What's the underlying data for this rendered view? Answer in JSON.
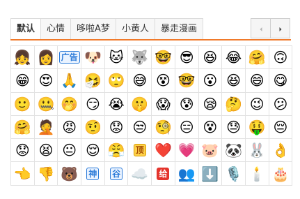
{
  "tabs": [
    {
      "label": "默认",
      "active": true
    },
    {
      "label": "心情",
      "active": false
    },
    {
      "label": "哆啦A梦",
      "active": false
    },
    {
      "label": "小黄人",
      "active": false
    },
    {
      "label": "暴走漫画",
      "active": false
    }
  ],
  "pager": {
    "prev_icon": "chevron-left-icon",
    "next_icon": "chevron-right-icon"
  },
  "colors": {
    "accent": "#f07a2b",
    "border": "#e2e2e2"
  },
  "emoticons": [
    [
      {
        "name": "girl-face-icon",
        "glyph": "👧"
      },
      {
        "name": "shy-girl-face-icon",
        "glyph": "👩"
      },
      {
        "name": "text-bubble-icon",
        "glyph": "广告",
        "style": "text"
      },
      {
        "name": "doge-icon",
        "glyph": "🐶"
      },
      {
        "name": "cat-face-icon",
        "glyph": "🐱"
      },
      {
        "name": "husky-icon",
        "glyph": "🐺"
      },
      {
        "name": "minion-icon",
        "glyph": "🤓"
      },
      {
        "name": "minion-goggles-icon",
        "glyph": "😎"
      },
      {
        "name": "minion-laugh-icon",
        "glyph": "😆"
      },
      {
        "name": "tears-of-joy-icon",
        "glyph": "😂"
      },
      {
        "name": "smile-hands-icon",
        "glyph": "🤗"
      },
      {
        "name": "shrug-icon",
        "glyph": "🙃"
      }
    ],
    [
      {
        "name": "grin-icon",
        "glyph": "😁"
      },
      {
        "name": "heart-eyes-icon",
        "glyph": "😍"
      },
      {
        "name": "pray-icon",
        "glyph": "🙏"
      },
      {
        "name": "sneeze-icon",
        "glyph": "🤧"
      },
      {
        "name": "rolling-eyes-icon",
        "glyph": "🙄"
      },
      {
        "name": "sweat-smile-icon",
        "glyph": "😅"
      },
      {
        "name": "puzzled-icon",
        "glyph": "😵"
      },
      {
        "name": "nerd-icon",
        "glyph": "🤓"
      },
      {
        "name": "surprised-icon",
        "glyph": "😮"
      },
      {
        "name": "laughing-icon",
        "glyph": "😆"
      },
      {
        "name": "laugh-cry-icon",
        "glyph": "😄"
      },
      {
        "name": "yum-icon",
        "glyph": "😋"
      }
    ],
    [
      {
        "name": "smile-icon",
        "glyph": "🙂"
      },
      {
        "name": "sealed-icon",
        "glyph": "🤐"
      },
      {
        "name": "cover-mouth-icon",
        "glyph": "🤭"
      },
      {
        "name": "smirk-icon",
        "glyph": "😏"
      },
      {
        "name": "cry-icon",
        "glyph": "😭"
      },
      {
        "name": "hush-icon",
        "glyph": "🤫"
      },
      {
        "name": "scream-icon",
        "glyph": "😱"
      },
      {
        "name": "cold-sweat-icon",
        "glyph": "😰"
      },
      {
        "name": "sleepy-icon",
        "glyph": "😪"
      },
      {
        "name": "think-icon",
        "glyph": "🤔"
      },
      {
        "name": "wink-icon",
        "glyph": "😉"
      },
      {
        "name": "confused-icon",
        "glyph": "😕"
      }
    ],
    [
      {
        "name": "hug-icon",
        "glyph": "🤗"
      },
      {
        "name": "facepalm-icon",
        "glyph": "🤦"
      },
      {
        "name": "angry-icon",
        "glyph": "😡"
      },
      {
        "name": "question-icon",
        "glyph": "🤨"
      },
      {
        "name": "frown-icon",
        "glyph": "😟"
      },
      {
        "name": "unamused-icon",
        "glyph": "😒"
      },
      {
        "name": "doubt-icon",
        "glyph": "🧐"
      },
      {
        "name": "expressionless-icon",
        "glyph": "😑"
      },
      {
        "name": "dizzy-face-icon",
        "glyph": "😵"
      },
      {
        "name": "sad-sweat-icon",
        "glyph": "😓"
      },
      {
        "name": "money-face-icon",
        "glyph": "🤑"
      },
      {
        "name": "pensive-icon",
        "glyph": "😔"
      }
    ],
    [
      {
        "name": "worried-icon",
        "glyph": "😟"
      },
      {
        "name": "shout-icon",
        "glyph": "😫"
      },
      {
        "name": "neutral-icon",
        "glyph": "😐"
      },
      {
        "name": "relieved-icon",
        "glyph": "😌"
      },
      {
        "name": "rage-icon",
        "glyph": "😤"
      },
      {
        "name": "doge-sign-icon",
        "glyph": "顶",
        "style": "gold"
      },
      {
        "name": "heart-icon",
        "glyph": "❤️"
      },
      {
        "name": "broken-heart-icon",
        "glyph": "💗"
      },
      {
        "name": "pig-icon",
        "glyph": "🐷"
      },
      {
        "name": "panda-icon",
        "glyph": "🐼"
      },
      {
        "name": "rabbit-icon",
        "glyph": "🐰"
      },
      {
        "name": "ok-hand-icon",
        "glyph": "👌"
      }
    ],
    [
      {
        "name": "point-left-icon",
        "glyph": "👈"
      },
      {
        "name": "thumbs-down-icon",
        "glyph": "👎"
      },
      {
        "name": "bear-icon",
        "glyph": "🐻"
      },
      {
        "name": "god-text-icon",
        "glyph": "神",
        "style": "text"
      },
      {
        "name": "valley-text-icon",
        "glyph": "谷",
        "style": "text"
      },
      {
        "name": "cloud-icon",
        "glyph": "☁️"
      },
      {
        "name": "give-text-icon",
        "glyph": "给",
        "style": "red"
      },
      {
        "name": "crowd-icon",
        "glyph": "👥"
      },
      {
        "name": "down-arrow-icon",
        "glyph": "⬇️"
      },
      {
        "name": "microphone-icon",
        "glyph": "🎙️"
      },
      {
        "name": "candle-icon",
        "glyph": "🕯️"
      },
      {
        "name": "cake-icon",
        "glyph": "🎂"
      }
    ]
  ]
}
